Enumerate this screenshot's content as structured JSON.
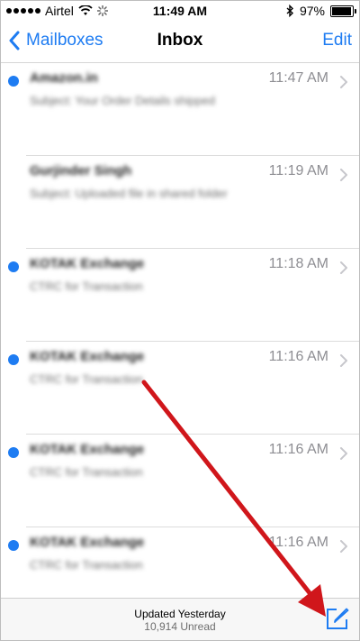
{
  "status_bar": {
    "carrier": "Airtel",
    "time": "11:49 AM",
    "battery_percent": "97%",
    "battery_level": 0.97
  },
  "nav": {
    "back_label": "Mailboxes",
    "title": "Inbox",
    "edit_label": "Edit"
  },
  "messages": [
    {
      "sender": "Amazon.in",
      "time": "11:47 AM",
      "preview": "Subject: Your Order Details shipped",
      "unread": true
    },
    {
      "sender": "Gurjinder Singh",
      "time": "11:19 AM",
      "preview": "Subject: Uploaded file in shared folder",
      "unread": false
    },
    {
      "sender": "KOTAK Exchange",
      "time": "11:18 AM",
      "preview": "CTRC for Transaction",
      "unread": true
    },
    {
      "sender": "KOTAK Exchange",
      "time": "11:16 AM",
      "preview": "CTRC for Transaction",
      "unread": true
    },
    {
      "sender": "KOTAK Exchange",
      "time": "11:16 AM",
      "preview": "CTRC for Transaction",
      "unread": true
    },
    {
      "sender": "KOTAK Exchange",
      "time": "11:16 AM",
      "preview": "CTRC for Transaction",
      "unread": true
    }
  ],
  "toolbar": {
    "updated": "Updated Yesterday",
    "unread_count": "10,914 Unread"
  },
  "colors": {
    "accent": "#1e7cf2",
    "annotation_arrow": "#d0161b"
  },
  "icons": {
    "back": "chevron-left-icon",
    "compose": "compose-icon",
    "row_chevron": "chevron-right-icon",
    "wifi": "wifi-icon",
    "bluetooth": "bluetooth-icon",
    "battery": "battery-icon"
  }
}
